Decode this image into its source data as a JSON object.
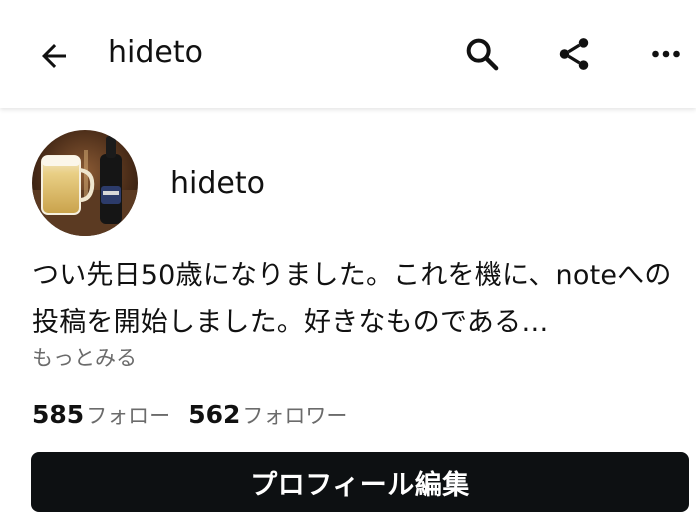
{
  "header": {
    "title": "hideto",
    "back_icon": "arrow-left-icon",
    "search_icon": "search-icon",
    "share_icon": "share-icon",
    "more_icon": "more-horizontal-icon"
  },
  "profile": {
    "name": "hideto",
    "avatar_icon": "avatar-photo-beer-glass",
    "bio": "つい先日50歳になりました。これを機に、noteへの投稿を開始しました。好きなものである…",
    "see_more_label": "もっとみる",
    "following_count": "585",
    "following_label": "フォロー",
    "followers_count": "562",
    "followers_label": "フォロワー",
    "edit_button_label": "プロフィール編集"
  },
  "colors": {
    "primary_button_bg": "#0d1012",
    "muted_text": "#6b6b6b",
    "text": "#111111"
  }
}
